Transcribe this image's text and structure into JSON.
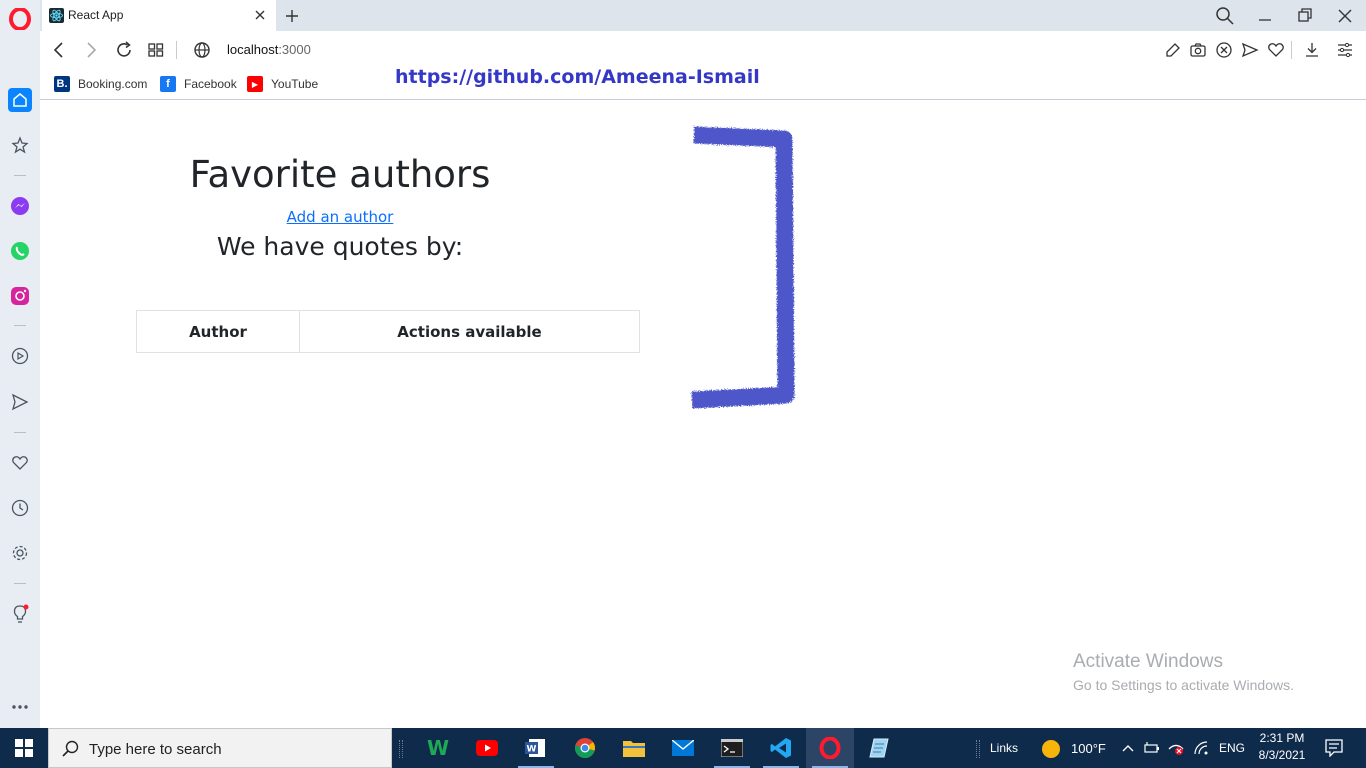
{
  "browser": {
    "tab_title": "React App",
    "url_host": "localhost",
    "url_port": ":3000"
  },
  "bookmarks": [
    {
      "label": "Booking.com",
      "icon": "booking-icon",
      "icon_text": "B.",
      "color": "#003580"
    },
    {
      "label": "Facebook",
      "icon": "facebook-icon",
      "icon_text": "f",
      "color": "#1877f2"
    },
    {
      "label": "YouTube",
      "icon": "youtube-icon",
      "icon_text": "▶",
      "color": "#ff0000"
    }
  ],
  "overlay": {
    "github_link": "https://github.com/Ameena-Ismail"
  },
  "page": {
    "title": "Favorite authors",
    "add_link": "Add an author",
    "subtitle": "We have quotes by:",
    "table": {
      "headers": [
        "Author",
        "Actions available"
      ],
      "rows": []
    }
  },
  "watermark": {
    "line1": "Activate Windows",
    "line2": "Go to Settings to activate Windows."
  },
  "taskbar": {
    "search_placeholder": "Type here to search",
    "links_label": "Links",
    "temperature": "100°F",
    "language": "ENG",
    "time": "2:31 PM",
    "date": "8/3/2021"
  },
  "colors": {
    "opera_red": "#ff1b2d",
    "link_blue": "#0d6efd",
    "github_blue": "#3538c6",
    "taskbar": "#0f2b4c"
  }
}
